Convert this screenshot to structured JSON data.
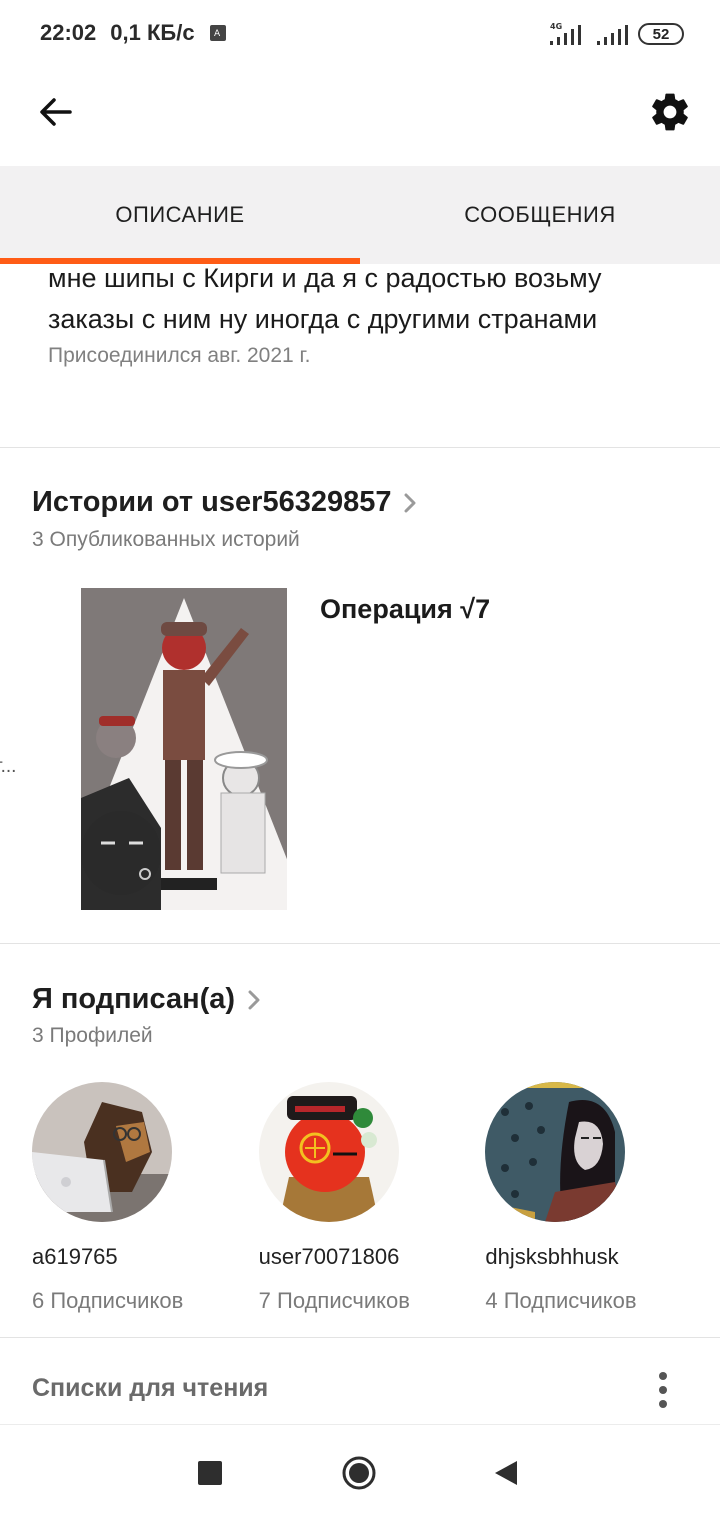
{
  "status_bar": {
    "time": "22:02",
    "speed": "0,1 КБ/с",
    "network": "4G",
    "battery": "52"
  },
  "app_bar": {
    "back_icon": "arrow-back-icon",
    "settings_icon": "gear-icon"
  },
  "tabs": [
    {
      "label": "ОПИСАНИЕ",
      "active": true
    },
    {
      "label": "СООБЩЕНИЯ",
      "active": false
    }
  ],
  "description": {
    "lines": [
      "мне шипы с Кирги и да я с радостью возьму",
      "заказы с ним ну иногда с другими странами"
    ],
    "joined": "Присоединился авг. 2021 г."
  },
  "stories": {
    "title": "Истории от user56329857",
    "subtitle": "3 Опубликованных историй",
    "prev_fragment": "т...",
    "story_title": "Операция √7"
  },
  "following": {
    "title": "Я подписан(а)",
    "subtitle": "3 Профилей",
    "profiles": [
      {
        "name": "a619765",
        "followers": "6 Подписчиков"
      },
      {
        "name": "user70071806",
        "followers": "7 Подписчиков"
      },
      {
        "name": "dhjsksbhhusk",
        "followers": "4 Подписчиков"
      }
    ]
  },
  "reading_lists": {
    "label": "Списки для чтения"
  },
  "colors": {
    "accent": "#ff5c16",
    "tab_bg": "#f2f1f2",
    "muted_text": "#7a7a7a"
  }
}
